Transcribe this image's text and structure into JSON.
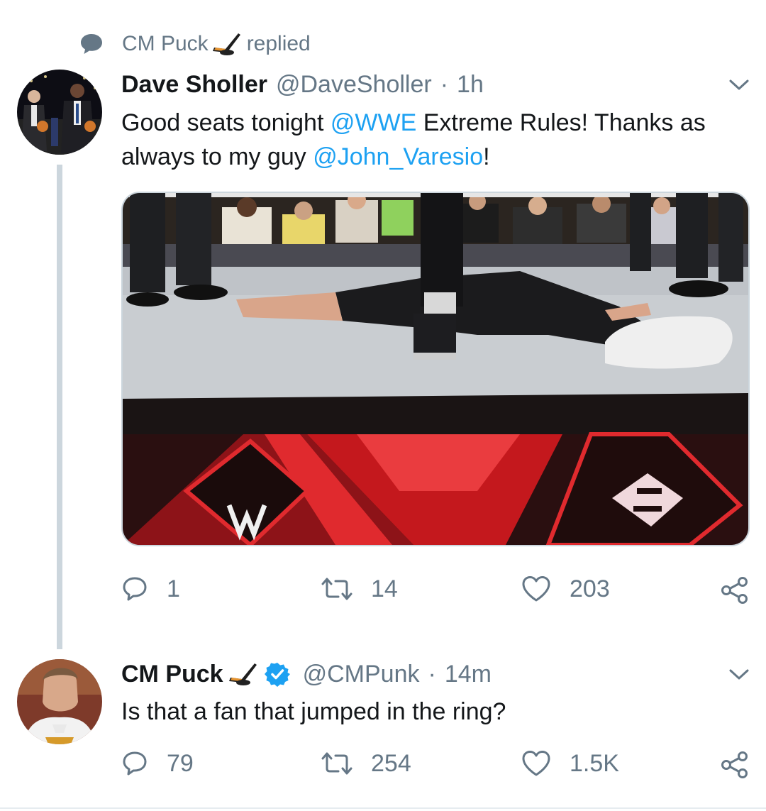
{
  "context": {
    "user": "CM Puck",
    "action": "replied"
  },
  "tweet1": {
    "name": "Dave Sholler",
    "handle": "@DaveSholler",
    "separator": "·",
    "time": "1h",
    "text_parts": {
      "p1": "Good seats tonight ",
      "m1": "@WWE",
      "p2": " Extreme Rules! Thanks as",
      "p3": "always to my guy ",
      "m2": "@John_Varesio",
      "p4": "!"
    },
    "actions": {
      "reply_count": "1",
      "retweet_count": "14",
      "like_count": "203"
    }
  },
  "tweet2": {
    "name": "CM Puck",
    "handle": "@CMPunk",
    "separator": "·",
    "time": "14m",
    "verified": true,
    "text": "Is that a fan that jumped in the ring?",
    "actions": {
      "reply_count": "79",
      "retweet_count": "254",
      "like_count": "1.5K"
    }
  },
  "colors": {
    "link": "#1da1f2",
    "muted": "#657786",
    "text": "#14171a",
    "verified": "#1da1f2",
    "thread_line": "#ccd6dd"
  },
  "icons": {
    "context": "speech-bubble-icon",
    "hockey": "hockey-stick-puck-icon",
    "menu": "chevron-down-icon",
    "reply": "reply-icon",
    "retweet": "retweet-icon",
    "like": "heart-icon",
    "share": "share-icon",
    "verified": "verified-badge-icon"
  }
}
